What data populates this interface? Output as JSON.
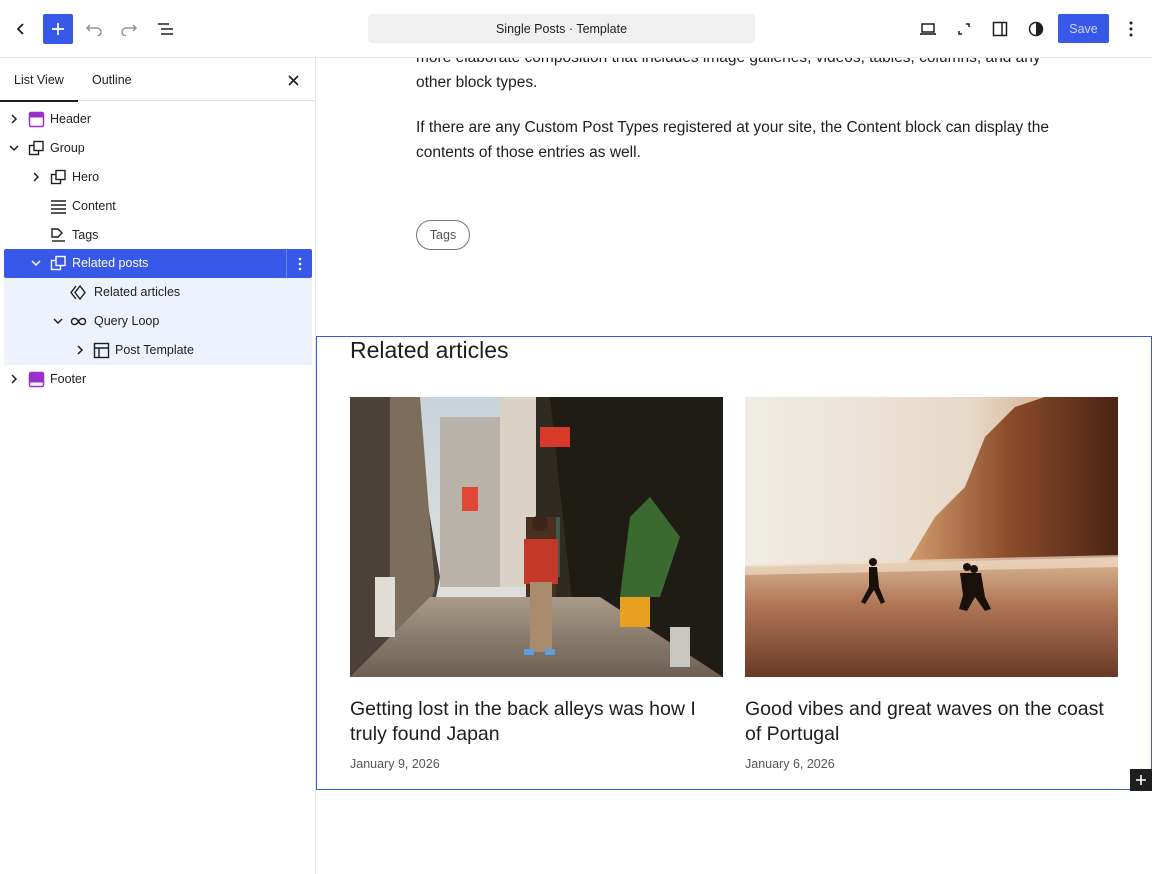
{
  "toolbar": {
    "document_title": "Single Posts · Template",
    "save_label": "Save",
    "accent_color": "#3858e9",
    "icons": [
      "back-icon",
      "add-icon",
      "undo-icon",
      "redo-icon",
      "document-overview-icon",
      "desktop-preview-icon",
      "fullscreen-icon",
      "settings-panel-icon",
      "styles-icon",
      "more-options-icon"
    ]
  },
  "sidebar": {
    "tabs": [
      {
        "label": "List View",
        "active": true
      },
      {
        "label": "Outline",
        "active": false
      }
    ],
    "tree": [
      {
        "label": "Header",
        "icon": "header-template-part-icon"
      },
      {
        "label": "Group",
        "icon": "group-icon"
      },
      {
        "label": "Hero",
        "icon": "group-icon"
      },
      {
        "label": "Content",
        "icon": "content-icon"
      },
      {
        "label": "Tags",
        "icon": "tags-icon"
      },
      {
        "label": "Related posts",
        "icon": "group-icon",
        "selected": true
      },
      {
        "label": "Related articles",
        "icon": "heading-icon"
      },
      {
        "label": "Query Loop",
        "icon": "loop-icon"
      },
      {
        "label": "Post Template",
        "icon": "layout-icon"
      },
      {
        "label": "Footer",
        "icon": "footer-template-part-icon"
      }
    ]
  },
  "canvas": {
    "para_top": "more elaborate composition that includes image galleries, videos, tables, columns, and any other block types.",
    "para_second": "If there are any Custom Post Types registered at your site, the Content block can display the contents of those entries as well.",
    "tags_label": "Tags",
    "related": {
      "heading": "Related articles",
      "cards": [
        {
          "title": "Getting lost in the back alleys was how I truly found Japan",
          "date": "January 9, 2026"
        },
        {
          "title": "Good vibes and great waves on the coast of Portugal",
          "date": "January 6, 2026"
        }
      ]
    }
  }
}
